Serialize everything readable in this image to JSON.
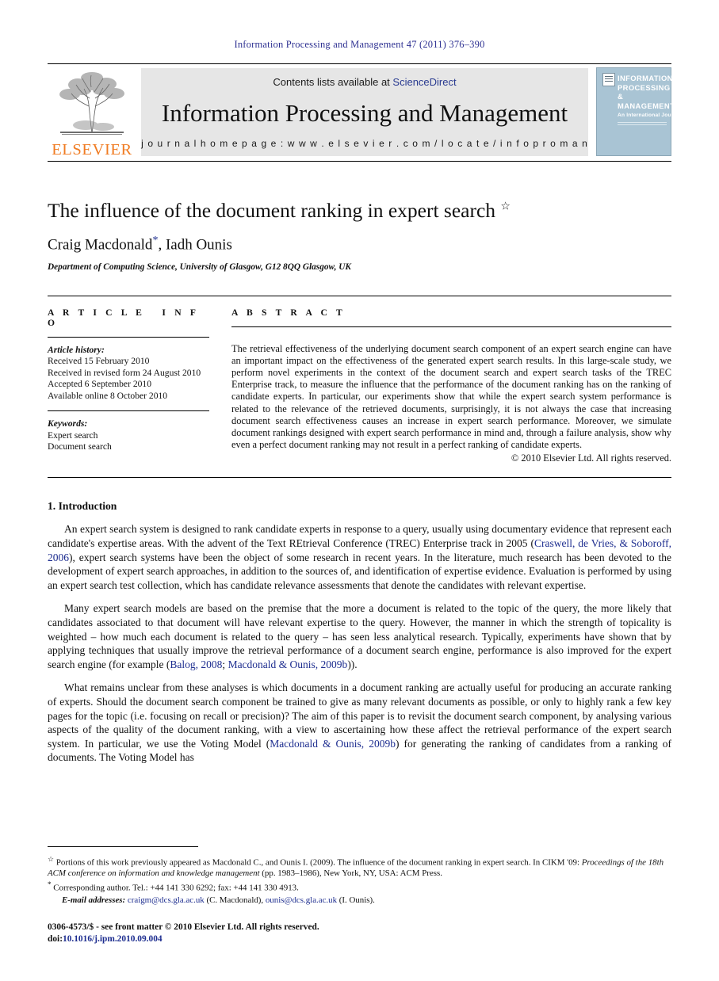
{
  "running_head": "Information Processing and Management 47 (2011) 376–390",
  "masthead": {
    "publisher_wordmark": "ELSEVIER",
    "contents_prefix": "Contents lists available at ",
    "sciencedirect": "ScienceDirect",
    "journal_title": "Information Processing and Management",
    "homepage": "j o u r n a l   h o m e p a g e :   w w w . e l s e v i e r . c o m / l o c a t e / i n f o p r o m a n",
    "cover": {
      "line1": "INFORMATION",
      "line2": "PROCESSING",
      "line3": "&",
      "line4": "MANAGEMENT",
      "subtitle": "An International Journal"
    }
  },
  "article": {
    "title": "The influence of the document ranking in expert search",
    "title_footnote_mark": "☆",
    "authors": "Craig Macdonald",
    "corresponding_mark": "*",
    "authors_rest": ", Iadh Ounis",
    "affiliation": "Department of Computing Science, University of Glasgow, G12 8QQ Glasgow, UK"
  },
  "info": {
    "heading": "ARTICLE INFO",
    "history_label": "Article history:",
    "history": [
      "Received 15 February 2010",
      "Received in revised form 24 August 2010",
      "Accepted 6 September 2010",
      "Available online 8 October 2010"
    ],
    "keywords_label": "Keywords:",
    "keywords": [
      "Expert search",
      "Document search"
    ]
  },
  "abstract": {
    "heading": "ABSTRACT",
    "text": "The retrieval effectiveness of the underlying document search component of an expert search engine can have an important impact on the effectiveness of the generated expert search results. In this large-scale study, we perform novel experiments in the context of the document search and expert search tasks of the TREC Enterprise track, to measure the influence that the performance of the document ranking has on the ranking of candidate experts. In particular, our experiments show that while the expert search system performance is related to the relevance of the retrieved documents, surprisingly, it is not always the case that increasing document search effectiveness causes an increase in expert search performance. Moreover, we simulate document rankings designed with expert search performance in mind and, through a failure analysis, show why even a perfect document ranking may not result in a perfect ranking of candidate experts.",
    "copyright": "© 2010 Elsevier Ltd. All rights reserved."
  },
  "body": {
    "section_number_title": "1. Introduction",
    "paragraph1_a": "An expert search system is designed to rank candidate experts in response to a query, usually using documentary evidence that represent each candidate's expertise areas. With the advent of the Text REtrieval Conference (TREC) Enterprise track in 2005 (",
    "paragraph1_cite": "Craswell, de Vries, & Soboroff, 2006",
    "paragraph1_b": "), expert search systems have been the object of some research in recent years. In the literature, much research has been devoted to the development of expert search approaches, in addition to the sources of, and identification of expertise evidence. Evaluation is performed by using an expert search test collection, which has candidate relevance assessments that denote the candidates with relevant expertise.",
    "paragraph2_a": "Many expert search models are based on the premise that the more a document is related to the topic of the query, the more likely that candidates associated to that document will have relevant expertise to the query. However, the manner in which the strength of topicality is weighted – how much each document is related to the query – has seen less analytical research. Typically, experiments have shown that by applying techniques that usually improve the retrieval performance of a document search engine, performance is also improved for the expert search engine (for example (",
    "paragraph2_cite1": "Balog, 2008",
    "paragraph2_mid": "; ",
    "paragraph2_cite2": "Macdonald & Ounis, 2009b",
    "paragraph2_b": ")).",
    "paragraph3_a": "What remains unclear from these analyses is which documents in a document ranking are actually useful for producing an accurate ranking of experts. Should the document search component be trained to give as many relevant documents as possible, or only to highly rank a few key pages for the topic (i.e. focusing on recall or precision)? The aim of this paper is to revisit the document search component, by analysing various aspects of the quality of the document ranking, with a view to ascertaining how these affect the retrieval performance of the expert search system. In particular, we use the Voting Model (",
    "paragraph3_cite": "Macdonald & Ounis, 2009b",
    "paragraph3_b": ") for generating the ranking of candidates from a ranking of documents. The Voting Model has"
  },
  "footnotes": {
    "star_mark": "☆",
    "star_text_a": "Portions of this work previously appeared as Macdonald C., and Ounis I. (2009). The influence of the document ranking in expert search. In CIKM '09: ",
    "star_text_italic": "Proceedings of the 18th ACM conference on information and knowledge management",
    "star_text_b": " (pp. 1983–1986), New York, NY, USA: ACM Press.",
    "corr_mark": "*",
    "corr_text": "Corresponding author. Tel.: +44 141 330 6292; fax: +44 141 330 4913.",
    "email_label": "E-mail addresses:",
    "email1": "craigm@dcs.gla.ac.uk",
    "email1_owner": " (C. Macdonald), ",
    "email2": "ounis@dcs.gla.ac.uk",
    "email2_owner": " (I. Ounis)."
  },
  "issn_footer": {
    "line1": "0306-4573/$ - see front matter © 2010 Elsevier Ltd. All rights reserved.",
    "doi_prefix": "doi:",
    "doi": "10.1016/j.ipm.2010.09.004"
  },
  "colors": {
    "running_head": "#2e3192",
    "link": "#1d2d8f",
    "elsevier_orange": "#f07c23",
    "banner_gray": "#e6e6e6",
    "cover_blue": "#a9c4d4"
  }
}
